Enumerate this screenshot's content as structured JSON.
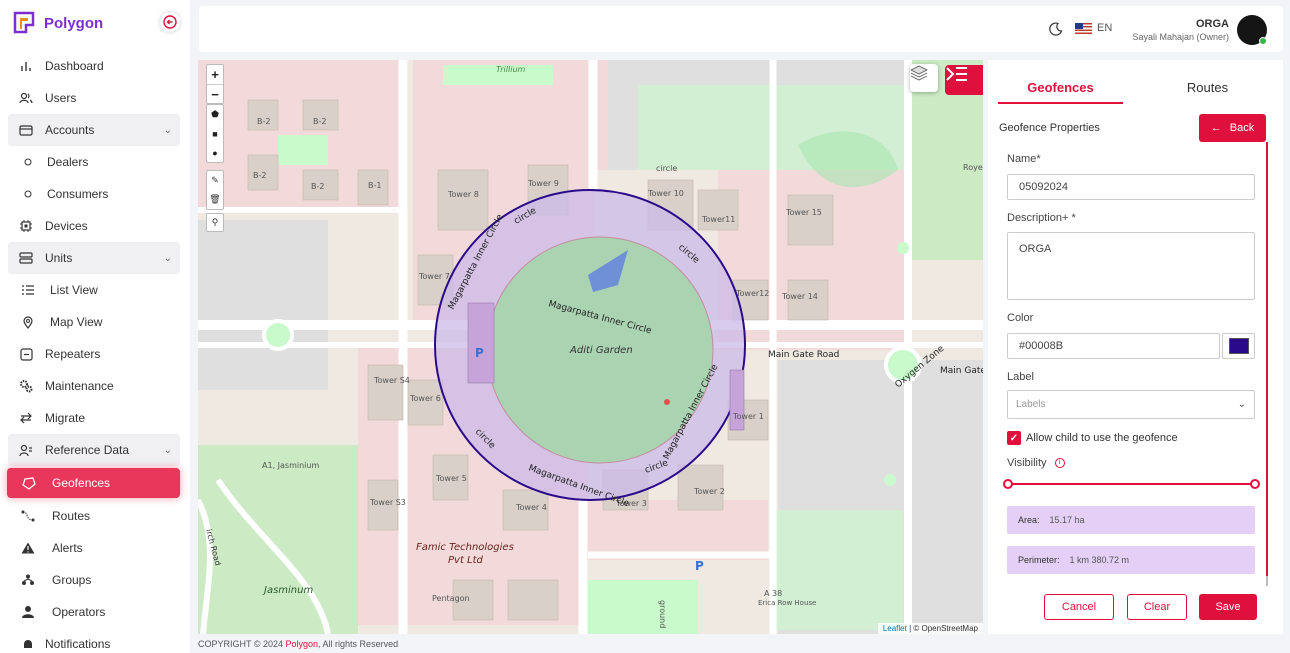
{
  "app": {
    "name": "Polygon"
  },
  "sidebar": {
    "items": [
      {
        "label": "Dashboard",
        "icon": "bar-chart-icon"
      },
      {
        "label": "Users",
        "icon": "users-icon"
      },
      {
        "label": "Accounts",
        "icon": "accounts-icon"
      },
      {
        "label": "Dealers",
        "icon": "circle-outline-icon"
      },
      {
        "label": "Consumers",
        "icon": "circle-outline-icon"
      },
      {
        "label": "Devices",
        "icon": "chip-icon"
      },
      {
        "label": "Units",
        "icon": "units-icon"
      },
      {
        "label": "List View",
        "icon": "list-icon"
      },
      {
        "label": "Map View",
        "icon": "map-pin-icon"
      },
      {
        "label": "Repeaters",
        "icon": "repeater-icon"
      },
      {
        "label": "Maintenance",
        "icon": "gears-icon"
      },
      {
        "label": "Migrate",
        "icon": "swap-icon"
      },
      {
        "label": "Reference Data",
        "icon": "reference-icon"
      },
      {
        "label": "Geofences",
        "icon": "geofence-icon"
      },
      {
        "label": "Routes",
        "icon": "route-icon"
      },
      {
        "label": "Alerts",
        "icon": "alert-icon"
      },
      {
        "label": "Groups",
        "icon": "groups-icon"
      },
      {
        "label": "Operators",
        "icon": "operators-icon"
      },
      {
        "label": "Notifications",
        "icon": "bell-icon"
      }
    ]
  },
  "header": {
    "language": "EN",
    "org_name": "ORGA",
    "user": "Sayali Mahajan (Owner)"
  },
  "map": {
    "attribution_leaflet": "Leaflet",
    "attribution_osm": "| © OpenStreetMap",
    "labels": {
      "garden": "Aditi Garden",
      "inner_circle": "Magarpatta Inner Circle",
      "circle": "circle",
      "main_gate_road": "Main Gate Road",
      "main_gate": "Main Gate",
      "oxygen_zone": "Oxygen Zone",
      "famic_1": "Famic Technologies",
      "famic_2": "Pvt Ltd",
      "jasminum": "Jasminum",
      "a1_jasminium": "A1, Jasminium",
      "pentagon": "Pentagon",
      "trillium": "Trillium",
      "tower_8": "Tower 8",
      "tower_9": "Tower 9",
      "tower_10": "Tower 10",
      "tower_11": "Tower11",
      "tower_15": "Tower 15",
      "tower_12": "Tower12",
      "tower_14": "Tower 14",
      "tower_7": "Tower 7",
      "tower_s4": "Tower S4",
      "tower_6": "Tower 6",
      "tower_5": "Tower 5",
      "tower_4": "Tower 4",
      "tower_s3": "Tower S3",
      "tower_3": "Tower 3",
      "tower_2": "Tower 2",
      "tower_1": "Tower 1",
      "b2": "B-2",
      "b1": "B-1",
      "a38": "A 38",
      "erica": "Erica Row House",
      "parking": "P",
      "roye": "Roye",
      "ground": "ground",
      "irch_road": "irch Road"
    },
    "geofence_color": "#00008B"
  },
  "panel": {
    "tab_geofences": "Geofences",
    "tab_routes": "Routes",
    "title": "Geofence Properties",
    "back_label": "Back",
    "name_label": "Name*",
    "name_value": "05092024",
    "description_label": "Description+ *",
    "description_value": "ORGA",
    "color_label": "Color",
    "color_value": "#00008B",
    "label_label": "Label",
    "label_placeholder": "Labels",
    "allow_child_label": "Allow child to use the geofence",
    "allow_child_checked": true,
    "visibility_label": "Visibility",
    "visibility_range": [
      0,
      1
    ],
    "area_key": "Area:",
    "area_value": "15.17 ha",
    "perimeter_key": "Perimeter:",
    "perimeter_value": "1 km 380.72 m",
    "cancel_label": "Cancel",
    "clear_label": "Clear",
    "save_label": "Save",
    "accent": "#E0103D"
  },
  "footer": {
    "copyright": "COPYRIGHT © 2024",
    "brand": "Polygon",
    "rights": ", All rights Reserved"
  }
}
